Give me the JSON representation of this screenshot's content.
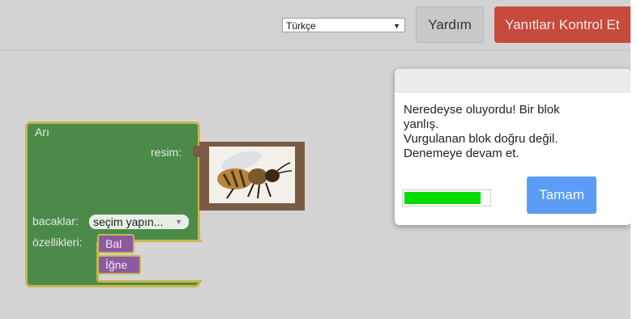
{
  "header": {
    "language_select": {
      "value": "Türkçe"
    },
    "help_label": "Yardım",
    "check_label": "Yanıtları Kontrol Et"
  },
  "workspace": {
    "block": {
      "title": "Arı",
      "image_label": "resim:",
      "legs_label": "bacaklar:",
      "legs_dropdown_value": "seçim yapın...",
      "properties_label": "özellikleri:",
      "properties": [
        "Bal",
        "İğne"
      ]
    }
  },
  "dialog": {
    "message_lines": [
      "Neredeyse oluyordu! Bir blok",
      "yanlış.",
      "Vurgulanan blok doğru değil.",
      "Denemeye devam et."
    ],
    "progress": 0.9,
    "ok_label": "Tamam"
  },
  "colors": {
    "block_green": "#4c8a4a",
    "block_outline": "#c9b74c",
    "chip_purple": "#8c5aa0",
    "check_button": "#c64b3d",
    "ok_button": "#5b9df4",
    "progress_fill": "#00dd00"
  },
  "icons": {
    "image": "bee-icon",
    "select_arrow": "triangle-down-icon"
  }
}
